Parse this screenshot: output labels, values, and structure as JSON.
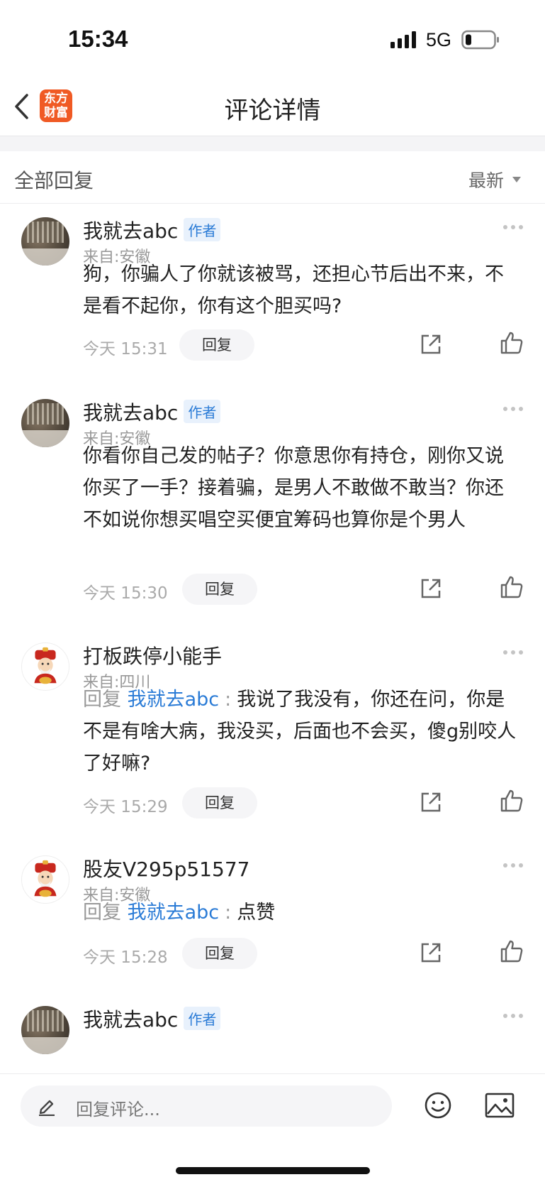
{
  "status_bar": {
    "time": "15:34",
    "network": "5G"
  },
  "nav": {
    "logo_line1": "东方",
    "logo_line2": "财富",
    "title": "评论详情"
  },
  "section": {
    "title": "全部回复",
    "sort_label": "最新"
  },
  "comments": [
    {
      "username": "我就去abc",
      "badge": "作者",
      "location": "来自:安徽",
      "text": "狗，你骗人了你就该被骂，还担心节后出不来，不是看不起你，你有这个胆买吗?",
      "time": "今天 15:31",
      "reply_label": "回复"
    },
    {
      "username": "我就去abc",
      "badge": "作者",
      "location": "来自:安徽",
      "text": "你看你自己发的帖子？你意思你有持仓，刚你又说你买了一手？接着骗，是男人不敢做不敢当？你还不如说你想买唱空买便宜筹码也算你是个男人",
      "time": "今天 15:30",
      "reply_label": "回复"
    },
    {
      "username": "打板跌停小能手",
      "location": "来自:四川",
      "reply_prefix": "回复",
      "reply_target": "我就去abc",
      "reply_sep": ":",
      "text": "我说了我没有，你还在问，你是不是有啥大病，我没买，后面也不会买，傻g别咬人了好嘛?",
      "time": "今天 15:29",
      "reply_label": "回复"
    },
    {
      "username": "股友V295p51577",
      "location": "来自:安徽",
      "reply_prefix": "回复",
      "reply_target": "我就去abc",
      "reply_sep": ":",
      "text": "点赞",
      "time": "今天 15:28",
      "reply_label": "回复"
    },
    {
      "username": "我就去abc",
      "badge": "作者"
    }
  ],
  "bottom_bar": {
    "input_placeholder": "回复评论..."
  }
}
